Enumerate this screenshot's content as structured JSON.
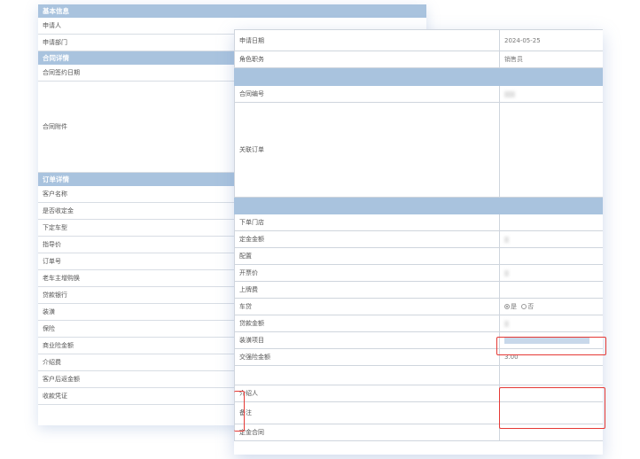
{
  "back": {
    "basic_header": "基本信息",
    "basic_rows": [
      "申请人",
      "申请部门"
    ],
    "contract_header": "合同详情",
    "contract_rows": [
      "合同签约日期"
    ],
    "contract_tall_label": "合同附件",
    "order_header": "订单详情",
    "order_rows": [
      "客户名称",
      "是否收定金",
      "下定车型",
      "指导价",
      "订单号",
      "老车主增购换",
      "贷款银行",
      "装潢",
      "保险",
      "商业险金额",
      "介绍费",
      "客户后返金额",
      "收款凭证"
    ]
  },
  "front": {
    "apply_date_label": "申请日期",
    "apply_date_value": "2024-05-25",
    "role_label": "角色职务",
    "role_value": "销售员",
    "contract_no_label": "合同编号",
    "related_order_label": "关联订单",
    "store_label": "下单门店",
    "deposit_amount_label": "定金金额",
    "config_label": "配置",
    "invoice_price_label": "开票价",
    "plate_fee_label": "上牌费",
    "loan_label": "车贷",
    "loan_yes": "是",
    "loan_no": "否",
    "loan_amount_label": "贷款金额",
    "decor_items_label": "装潢项目",
    "ci_amount_label": "交强险金额",
    "ci_amount_value": "3.00",
    "introducer_label": "介绍人",
    "remark_label": "备注",
    "sales_contract_label": "定金合同"
  }
}
